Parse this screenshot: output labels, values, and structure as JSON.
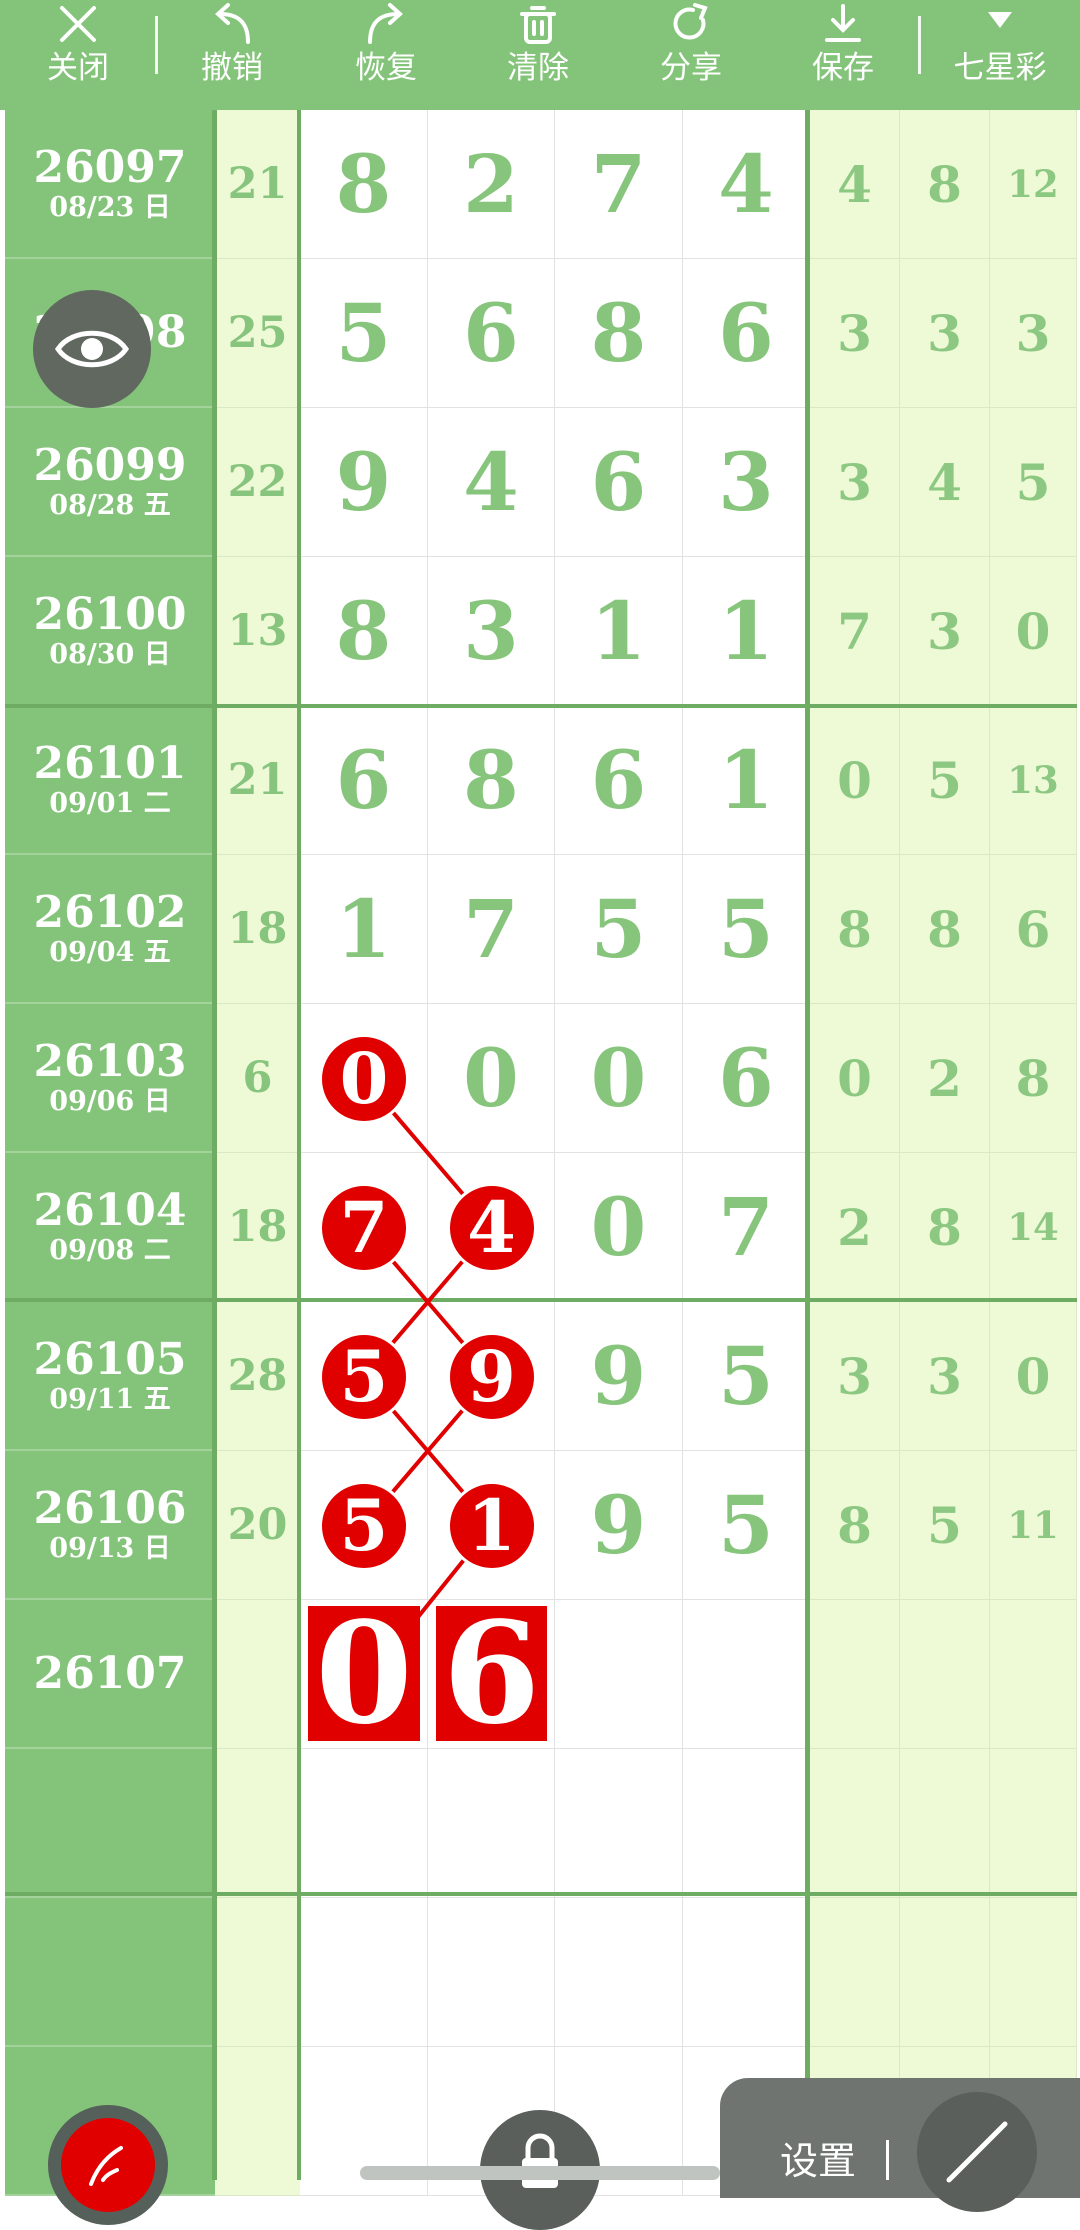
{
  "toolbar": {
    "close": "关闭",
    "undo": "撤销",
    "redo": "恢复",
    "clear": "清除",
    "share": "分享",
    "save": "保存",
    "lottery": "七星彩"
  },
  "rows": [
    {
      "id": "26097",
      "date": "08/23 日",
      "sum": "21",
      "digits": [
        "8",
        "2",
        "7",
        "4"
      ],
      "gaps": [
        "4",
        "8",
        "12"
      ]
    },
    {
      "id": "26098",
      "date": "",
      "sum": "25",
      "digits": [
        "5",
        "6",
        "8",
        "6"
      ],
      "gaps": [
        "3",
        "3",
        "3"
      ]
    },
    {
      "id": "26099",
      "date": "08/28 五",
      "sum": "22",
      "digits": [
        "9",
        "4",
        "6",
        "3"
      ],
      "gaps": [
        "3",
        "4",
        "5"
      ]
    },
    {
      "id": "26100",
      "date": "08/30 日",
      "sum": "13",
      "digits": [
        "8",
        "3",
        "1",
        "1"
      ],
      "gaps": [
        "7",
        "3",
        "0"
      ]
    },
    {
      "id": "26101",
      "date": "09/01 二",
      "sum": "21",
      "digits": [
        "6",
        "8",
        "6",
        "1"
      ],
      "gaps": [
        "0",
        "5",
        "13"
      ]
    },
    {
      "id": "26102",
      "date": "09/04 五",
      "sum": "18",
      "digits": [
        "1",
        "7",
        "5",
        "5"
      ],
      "gaps": [
        "8",
        "8",
        "6"
      ]
    },
    {
      "id": "26103",
      "date": "09/06 日",
      "sum": "6",
      "digits": [
        "0",
        "0",
        "0",
        "6"
      ],
      "gaps": [
        "0",
        "2",
        "8"
      ]
    },
    {
      "id": "26104",
      "date": "09/08 二",
      "sum": "18",
      "digits": [
        "7",
        "4",
        "0",
        "7"
      ],
      "gaps": [
        "2",
        "8",
        "14"
      ]
    },
    {
      "id": "26105",
      "date": "09/11 五",
      "sum": "28",
      "digits": [
        "5",
        "9",
        "9",
        "5"
      ],
      "gaps": [
        "3",
        "3",
        "0"
      ]
    },
    {
      "id": "26106",
      "date": "09/13 日",
      "sum": "20",
      "digits": [
        "5",
        "1",
        "9",
        "5"
      ],
      "gaps": [
        "8",
        "5",
        "11"
      ]
    },
    {
      "id": "26107",
      "date": "",
      "sum": "",
      "digits": [
        "",
        "",
        "",
        ""
      ],
      "gaps": [
        "",
        "",
        ""
      ]
    },
    {
      "id": "",
      "date": "",
      "sum": "",
      "digits": [
        "",
        "",
        "",
        ""
      ],
      "gaps": [
        "",
        "",
        ""
      ]
    },
    {
      "id": "",
      "date": "",
      "sum": "",
      "digits": [
        "",
        "",
        "",
        ""
      ],
      "gaps": [
        "",
        "",
        ""
      ]
    },
    {
      "id": "",
      "date": "",
      "sum": "",
      "digits": [
        "",
        "",
        "",
        ""
      ],
      "gaps": [
        "",
        "",
        ""
      ]
    }
  ],
  "marked_digits": [
    {
      "row": 6,
      "col": 0
    },
    {
      "row": 7,
      "col": 0
    },
    {
      "row": 7,
      "col": 1
    },
    {
      "row": 8,
      "col": 0
    },
    {
      "row": 8,
      "col": 1
    },
    {
      "row": 9,
      "col": 0
    },
    {
      "row": 9,
      "col": 1
    }
  ],
  "prediction": {
    "row": 10,
    "digits": [
      "0",
      "6"
    ]
  },
  "settings": {
    "label": "设置"
  },
  "colors": {
    "header_green": "#84c47a",
    "light_green": "#eefad6",
    "digit_green": "#86c57b",
    "mark_red": "#e00000",
    "overlay_gray": "#606860"
  },
  "icons": [
    "close-icon",
    "undo-icon",
    "redo-icon",
    "trash-icon",
    "share-icon",
    "download-icon",
    "dropdown-icon",
    "eye-icon",
    "pen-icon",
    "lock-icon",
    "line-tool-icon"
  ]
}
